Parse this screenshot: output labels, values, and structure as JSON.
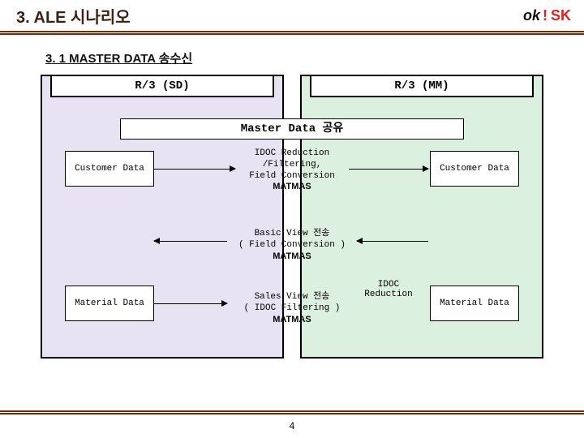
{
  "header": {
    "title": "3.  ALE 시나리오",
    "logo_ok": "ok",
    "logo_bang": "!",
    "logo_sk": "SK"
  },
  "subtitle": "3. 1 MASTER DATA 송수신",
  "panels": {
    "left_header": "R/3 (SD)",
    "right_header": "R/3 (MM)"
  },
  "boxes": {
    "center_header": "Master Data 공유",
    "customer_left": "Customer Data",
    "customer_right": "Customer Data",
    "material_left": "Material Data",
    "material_right": "Material Data"
  },
  "processes": {
    "p1_line1": "IDOC Reduction",
    "p1_line2": "/Filtering,",
    "p1_line3": "Field Conversion",
    "p1_matmas": "MATMAS",
    "p2_line1": "Basic View 전송",
    "p2_line2": "( Field Conversion )",
    "p2_matmas": "MATMAS",
    "p3_line1": "Sales View 전송",
    "p3_line2": "( IDOC Filtering )",
    "p3_matmas": "MATMAS",
    "idoc_reduction": "IDOC Reduction"
  },
  "page_number": "4"
}
